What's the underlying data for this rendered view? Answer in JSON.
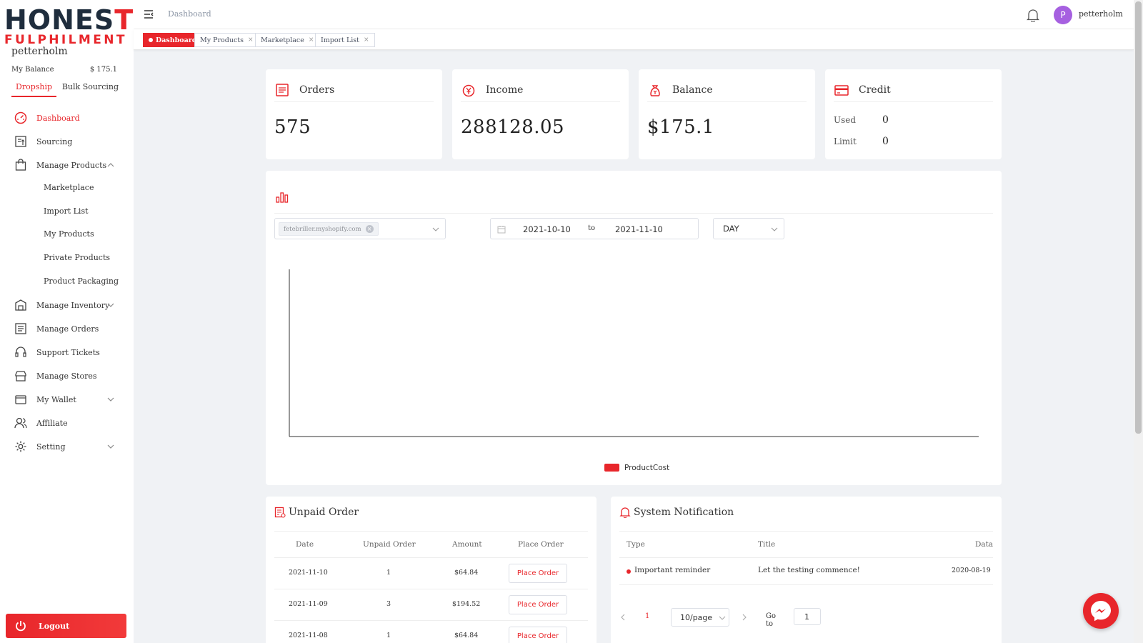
{
  "brand": {
    "logo_line1": "HONEST",
    "logo_line2": "FULPHILMENT",
    "accent": "#e8262b"
  },
  "sidebar": {
    "username": "petterholm",
    "balance_label": "My Balance",
    "balance_value": "$ 175.1",
    "mode_tabs": [
      "Dropship",
      "Bulk Sourcing"
    ],
    "menu": [
      {
        "label": "Dashboard",
        "icon": "dashboard-gauge-icon"
      },
      {
        "label": "Sourcing",
        "icon": "sourcing-icon"
      },
      {
        "label": "Manage Products",
        "icon": "shopping-bag-icon"
      },
      {
        "label": "Manage Inventory",
        "icon": "warehouse-icon"
      },
      {
        "label": "Manage Orders",
        "icon": "orders-list-icon"
      },
      {
        "label": "Support Tickets",
        "icon": "headset-icon"
      },
      {
        "label": "Manage Stores",
        "icon": "store-icon"
      },
      {
        "label": "My Wallet",
        "icon": "wallet-icon"
      },
      {
        "label": "Affiliate",
        "icon": "users-icon"
      },
      {
        "label": "Setting",
        "icon": "gear-icon"
      }
    ],
    "sub_menu": [
      "Marketplace",
      "Import List",
      "My Products",
      "Private Products",
      "Product Packaging"
    ],
    "logout_label": "Logout"
  },
  "header": {
    "breadcrumb": "Dashboard",
    "avatar_letter": "P",
    "username": "petterholm"
  },
  "tabs": [
    {
      "label": "Dashboard",
      "active": true
    },
    {
      "label": "My Products",
      "active": false
    },
    {
      "label": "Marketplace",
      "active": false
    },
    {
      "label": "Import List",
      "active": false
    }
  ],
  "stats": {
    "orders": {
      "title": "Orders",
      "value": "575"
    },
    "income": {
      "title": "Income",
      "value": "288128.05"
    },
    "balance": {
      "title": "Balance",
      "value": "$175.1"
    },
    "credit": {
      "title": "Credit",
      "used_label": "Used",
      "used_value": "0",
      "limit_label": "Limit",
      "limit_value": "0"
    }
  },
  "chart_panel": {
    "store_chip": "fetebriller.myshopify.com",
    "date_from": "2021-10-10",
    "date_to_label": "to",
    "date_to": "2021-11-10",
    "period": "DAY"
  },
  "chart_data": {
    "type": "bar",
    "categories": [],
    "series": [
      {
        "name": "ProductCost",
        "values": []
      }
    ],
    "legend_color": "#e8262b",
    "title": "",
    "xlabel": "",
    "ylabel": ""
  },
  "unpaid": {
    "title": "Unpaid Order",
    "columns": [
      "Date",
      "Unpaid Order",
      "Amount",
      "Place Order"
    ],
    "rows": [
      {
        "date": "2021-11-10",
        "count": "1",
        "amount": "$64.84",
        "action": "Place Order"
      },
      {
        "date": "2021-11-09",
        "count": "3",
        "amount": "$194.52",
        "action": "Place Order"
      },
      {
        "date": "2021-11-08",
        "count": "1",
        "amount": "$64.84",
        "action": "Place Order"
      }
    ]
  },
  "notifications": {
    "title": "System Notification",
    "columns": [
      "Type",
      "Title",
      "Data"
    ],
    "rows": [
      {
        "type": "Important reminder",
        "title": "Let the testing commence!",
        "date": "2020-08-19"
      }
    ],
    "pager": {
      "current_page": "1",
      "page_size": "10/page",
      "goto_label": "Go to",
      "goto_value": "1"
    }
  }
}
